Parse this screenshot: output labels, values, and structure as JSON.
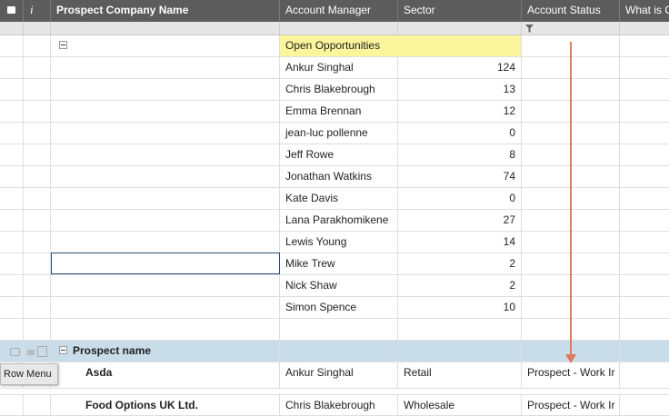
{
  "header": {
    "columns": [
      "Prospect Company Name",
      "Account Manager",
      "Sector",
      "Account Status",
      "What is C"
    ],
    "info_icon": "i"
  },
  "group_open": {
    "label": "Open Opportunities",
    "rows": [
      {
        "manager": "Ankur Singhal",
        "value": "124"
      },
      {
        "manager": "Chris Blakebrough",
        "value": "13"
      },
      {
        "manager": "Emma Brennan",
        "value": "12"
      },
      {
        "manager": "jean-luc pollenne",
        "value": "0"
      },
      {
        "manager": "Jeff Rowe",
        "value": "8"
      },
      {
        "manager": "Jonathan Watkins",
        "value": "74"
      },
      {
        "manager": "Kate Davis",
        "value": "0"
      },
      {
        "manager": "Lana Parakhomikene",
        "value": "27"
      },
      {
        "manager": "Lewis Young",
        "value": "14"
      },
      {
        "manager": "Mike Trew",
        "value": "2"
      },
      {
        "manager": "Nick Shaw",
        "value": "2"
      },
      {
        "manager": "Simon Spence",
        "value": "10"
      }
    ]
  },
  "group_prospect": {
    "label": "Prospect name",
    "rows": [
      {
        "company": "Asda",
        "manager": "Ankur Singhal",
        "sector": "Retail",
        "status": "Prospect - Work Ir"
      },
      {
        "company": "Food Options UK Ltd.",
        "manager": "Chris Blakebrough",
        "sector": "Wholesale",
        "status": "Prospect - Work Ir"
      }
    ]
  },
  "row_menu": {
    "label": "Row Menu"
  },
  "colors": {
    "header_bg": "#5c5c5c",
    "group_highlight": "#fbf59b",
    "selected_row": "#c9dcea",
    "annotation_arrow": "#e07a5a"
  }
}
